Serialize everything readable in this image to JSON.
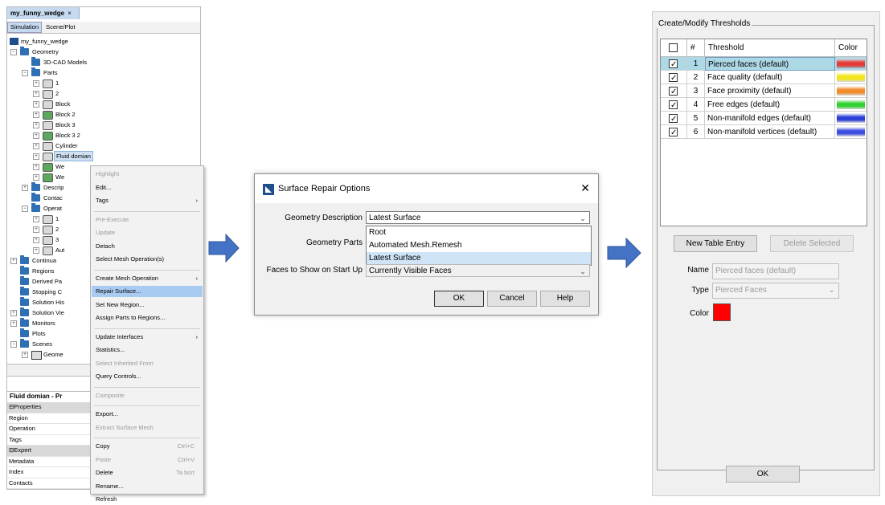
{
  "left": {
    "doc_tab": "my_funny_wedge",
    "doc_tab_close": "×",
    "subtabs": [
      "Simulation",
      "Scene/Plot"
    ],
    "tree": {
      "root": "my_funny_wedge",
      "geometry": "Geometry",
      "cad_models": "3D-CAD Models",
      "parts": "Parts",
      "part_1": "1",
      "part_2": "2",
      "block": "Block",
      "block_2": "Block 2",
      "block_3": "Block 3",
      "block_3_2": "Block 3 2",
      "cylinder": "Cylinder",
      "fluid_domian": "Fluid domian",
      "we_1": "We",
      "we_2": "We",
      "descrip": "Descrip",
      "contac": "Contac",
      "operat": "Operat",
      "op_1": "1",
      "op_2": "2",
      "op_3": "3",
      "aut": "Aut",
      "continua": "Continua",
      "regions": "Regions",
      "derived": "Derived Pa",
      "stopping": "Stopping C",
      "solution_his": "Solution His",
      "solution_vie": "Solution Vie",
      "monitors": "Monitors",
      "plots": "Plots",
      "scenes": "Scenes",
      "geome": "Geome"
    },
    "properties_title": "Fluid domian - Pr",
    "properties": [
      "Properties",
      "Region",
      "Operation",
      "Tags",
      "Expert",
      "Metadata",
      "Index",
      "Contacts"
    ]
  },
  "context_menu": {
    "items": [
      {
        "label": "Highlight",
        "disabled": true
      },
      {
        "label": "Edit..."
      },
      {
        "label": "Tags",
        "submenu": true
      },
      {
        "label": "Pre-Execute",
        "disabled": true
      },
      {
        "label": "Update",
        "disabled": true
      },
      {
        "label": "Detach"
      },
      {
        "label": "Select Mesh Operation(s)"
      },
      {
        "label": "Create Mesh Operation",
        "submenu": true
      },
      {
        "label": "Repair Surface...",
        "highlighted": true
      },
      {
        "label": "Set New Region..."
      },
      {
        "label": "Assign Parts to Regions..."
      },
      {
        "label": "Update Interfaces",
        "submenu": true
      },
      {
        "label": "Statistics..."
      },
      {
        "label": "Select Inherited From",
        "disabled": true
      },
      {
        "label": "Query Controls..."
      },
      {
        "label": "Composite",
        "disabled": true
      },
      {
        "label": "Export..."
      },
      {
        "label": "Extract Surface Mesh",
        "disabled": true
      },
      {
        "label": "Copy",
        "shortcut": "Ctrl+C"
      },
      {
        "label": "Paste",
        "shortcut": "Ctrl+V",
        "disabled": true
      },
      {
        "label": "Delete",
        "shortcut": "Ta bort"
      },
      {
        "label": "Rename..."
      },
      {
        "label": "Refresh"
      }
    ],
    "submenu_arrow": "›"
  },
  "dialog": {
    "title": "Surface Repair Options",
    "close": "✕",
    "geometry_description_label": "Geometry Description",
    "geometry_description_value": "Latest Surface",
    "geometry_parts_label": "Geometry Parts",
    "faces_label": "Faces to Show on Start Up",
    "faces_value": "Currently Visible Faces",
    "dropdown_options": [
      "Root",
      "Automated Mesh.Remesh",
      "Latest Surface"
    ],
    "ok": "OK",
    "cancel": "Cancel",
    "help": "Help",
    "dropdown_arrow": "⌄"
  },
  "thresholds": {
    "group_title": "Create/Modify Thresholds",
    "headers": {
      "num": "#",
      "threshold": "Threshold",
      "color": "Color"
    },
    "rows": [
      {
        "num": "1",
        "name": "Pierced faces (default)",
        "color": "#e53935",
        "checked": true,
        "selected": true
      },
      {
        "num": "2",
        "name": "Face quality (default)",
        "color": "#f2e51a",
        "checked": true
      },
      {
        "num": "3",
        "name": "Face proximity (default)",
        "color": "#f28b2c",
        "checked": true
      },
      {
        "num": "4",
        "name": "Free edges (default)",
        "color": "#2fd12f",
        "checked": true
      },
      {
        "num": "5",
        "name": "Non-manifold edges (default)",
        "color": "#2b3fd6",
        "checked": true
      },
      {
        "num": "6",
        "name": "Non-manifold vertices (default)",
        "color": "#3d4fe0",
        "checked": true
      }
    ],
    "check_mark": "✓",
    "new_entry": "New Table Entry",
    "delete_selected": "Delete Selected",
    "name_label": "Name",
    "name_value": "Pierced faces (default)",
    "type_label": "Type",
    "type_value": "Pierced Faces",
    "color_label": "Color",
    "color_value": "#ff0000",
    "ok": "OK"
  },
  "colors": {
    "arrow": "#4472c4",
    "selection": "#add8e6",
    "menu_highlight": "#a9cbf2"
  }
}
